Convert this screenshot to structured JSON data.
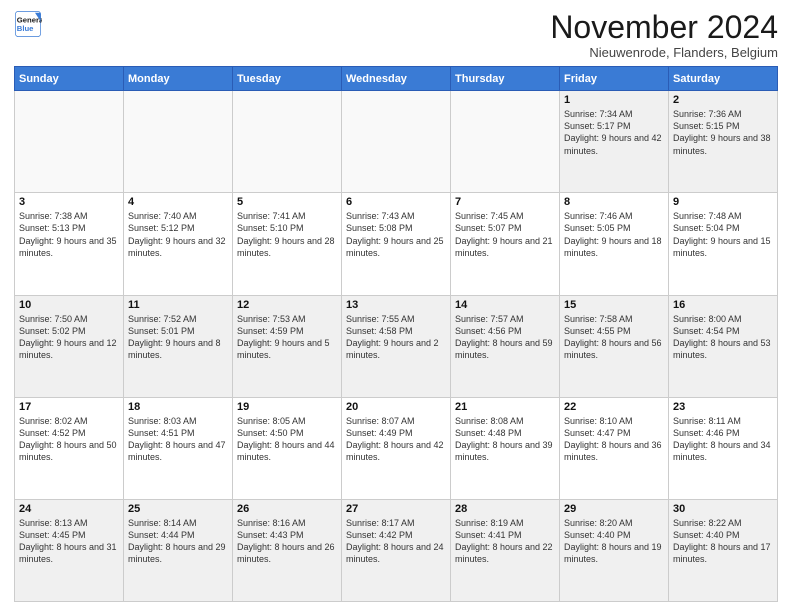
{
  "logo": {
    "line1": "General",
    "line2": "Blue"
  },
  "title": "November 2024",
  "subtitle": "Nieuwenrode, Flanders, Belgium",
  "headers": [
    "Sunday",
    "Monday",
    "Tuesday",
    "Wednesday",
    "Thursday",
    "Friday",
    "Saturday"
  ],
  "weeks": [
    [
      {
        "day": "",
        "text": "",
        "empty": true
      },
      {
        "day": "",
        "text": "",
        "empty": true
      },
      {
        "day": "",
        "text": "",
        "empty": true
      },
      {
        "day": "",
        "text": "",
        "empty": true
      },
      {
        "day": "",
        "text": "",
        "empty": true
      },
      {
        "day": "1",
        "text": "Sunrise: 7:34 AM\nSunset: 5:17 PM\nDaylight: 9 hours and 42 minutes.",
        "empty": false
      },
      {
        "day": "2",
        "text": "Sunrise: 7:36 AM\nSunset: 5:15 PM\nDaylight: 9 hours and 38 minutes.",
        "empty": false
      }
    ],
    [
      {
        "day": "3",
        "text": "Sunrise: 7:38 AM\nSunset: 5:13 PM\nDaylight: 9 hours and 35 minutes.",
        "empty": false
      },
      {
        "day": "4",
        "text": "Sunrise: 7:40 AM\nSunset: 5:12 PM\nDaylight: 9 hours and 32 minutes.",
        "empty": false
      },
      {
        "day": "5",
        "text": "Sunrise: 7:41 AM\nSunset: 5:10 PM\nDaylight: 9 hours and 28 minutes.",
        "empty": false
      },
      {
        "day": "6",
        "text": "Sunrise: 7:43 AM\nSunset: 5:08 PM\nDaylight: 9 hours and 25 minutes.",
        "empty": false
      },
      {
        "day": "7",
        "text": "Sunrise: 7:45 AM\nSunset: 5:07 PM\nDaylight: 9 hours and 21 minutes.",
        "empty": false
      },
      {
        "day": "8",
        "text": "Sunrise: 7:46 AM\nSunset: 5:05 PM\nDaylight: 9 hours and 18 minutes.",
        "empty": false
      },
      {
        "day": "9",
        "text": "Sunrise: 7:48 AM\nSunset: 5:04 PM\nDaylight: 9 hours and 15 minutes.",
        "empty": false
      }
    ],
    [
      {
        "day": "10",
        "text": "Sunrise: 7:50 AM\nSunset: 5:02 PM\nDaylight: 9 hours and 12 minutes.",
        "empty": false
      },
      {
        "day": "11",
        "text": "Sunrise: 7:52 AM\nSunset: 5:01 PM\nDaylight: 9 hours and 8 minutes.",
        "empty": false
      },
      {
        "day": "12",
        "text": "Sunrise: 7:53 AM\nSunset: 4:59 PM\nDaylight: 9 hours and 5 minutes.",
        "empty": false
      },
      {
        "day": "13",
        "text": "Sunrise: 7:55 AM\nSunset: 4:58 PM\nDaylight: 9 hours and 2 minutes.",
        "empty": false
      },
      {
        "day": "14",
        "text": "Sunrise: 7:57 AM\nSunset: 4:56 PM\nDaylight: 8 hours and 59 minutes.",
        "empty": false
      },
      {
        "day": "15",
        "text": "Sunrise: 7:58 AM\nSunset: 4:55 PM\nDaylight: 8 hours and 56 minutes.",
        "empty": false
      },
      {
        "day": "16",
        "text": "Sunrise: 8:00 AM\nSunset: 4:54 PM\nDaylight: 8 hours and 53 minutes.",
        "empty": false
      }
    ],
    [
      {
        "day": "17",
        "text": "Sunrise: 8:02 AM\nSunset: 4:52 PM\nDaylight: 8 hours and 50 minutes.",
        "empty": false
      },
      {
        "day": "18",
        "text": "Sunrise: 8:03 AM\nSunset: 4:51 PM\nDaylight: 8 hours and 47 minutes.",
        "empty": false
      },
      {
        "day": "19",
        "text": "Sunrise: 8:05 AM\nSunset: 4:50 PM\nDaylight: 8 hours and 44 minutes.",
        "empty": false
      },
      {
        "day": "20",
        "text": "Sunrise: 8:07 AM\nSunset: 4:49 PM\nDaylight: 8 hours and 42 minutes.",
        "empty": false
      },
      {
        "day": "21",
        "text": "Sunrise: 8:08 AM\nSunset: 4:48 PM\nDaylight: 8 hours and 39 minutes.",
        "empty": false
      },
      {
        "day": "22",
        "text": "Sunrise: 8:10 AM\nSunset: 4:47 PM\nDaylight: 8 hours and 36 minutes.",
        "empty": false
      },
      {
        "day": "23",
        "text": "Sunrise: 8:11 AM\nSunset: 4:46 PM\nDaylight: 8 hours and 34 minutes.",
        "empty": false
      }
    ],
    [
      {
        "day": "24",
        "text": "Sunrise: 8:13 AM\nSunset: 4:45 PM\nDaylight: 8 hours and 31 minutes.",
        "empty": false
      },
      {
        "day": "25",
        "text": "Sunrise: 8:14 AM\nSunset: 4:44 PM\nDaylight: 8 hours and 29 minutes.",
        "empty": false
      },
      {
        "day": "26",
        "text": "Sunrise: 8:16 AM\nSunset: 4:43 PM\nDaylight: 8 hours and 26 minutes.",
        "empty": false
      },
      {
        "day": "27",
        "text": "Sunrise: 8:17 AM\nSunset: 4:42 PM\nDaylight: 8 hours and 24 minutes.",
        "empty": false
      },
      {
        "day": "28",
        "text": "Sunrise: 8:19 AM\nSunset: 4:41 PM\nDaylight: 8 hours and 22 minutes.",
        "empty": false
      },
      {
        "day": "29",
        "text": "Sunrise: 8:20 AM\nSunset: 4:40 PM\nDaylight: 8 hours and 19 minutes.",
        "empty": false
      },
      {
        "day": "30",
        "text": "Sunrise: 8:22 AM\nSunset: 4:40 PM\nDaylight: 8 hours and 17 minutes.",
        "empty": false
      }
    ]
  ]
}
